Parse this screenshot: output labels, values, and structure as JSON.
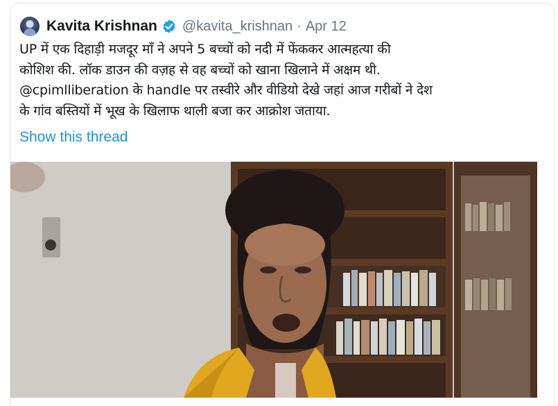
{
  "tweet": {
    "author_name": "Kavita Krishnan",
    "handle": "@kavita_krishnan",
    "separator": "·",
    "date": "Apr 12",
    "verified": true,
    "text_lines": [
      "UP में एक दिहाड़ी मजदूर माँ ने अपने 5 बच्चों को नदी में फेंककर आत्महत्या की",
      "कोशिश की. लॉक डाउन की वज़ह से वह बच्चों को खाना खिलाने में अक्षम थी.",
      "@cpimlliberation के handle पर तस्वीरे और वीडियो देखे जहां आज गरीबों ने देश",
      "के गांव बस्तियों में भूख के खिलाफ थाली बजा कर आक्रोश जताया."
    ],
    "show_thread_label": "Show this thread"
  },
  "colors": {
    "link": "#1b95e0",
    "verified_badge": "#1da1f2",
    "text": "#14171a",
    "meta": "#657786",
    "border": "#e1e8ed"
  },
  "icons": {
    "verified": "verified-badge-icon",
    "avatar": "profile-avatar"
  }
}
